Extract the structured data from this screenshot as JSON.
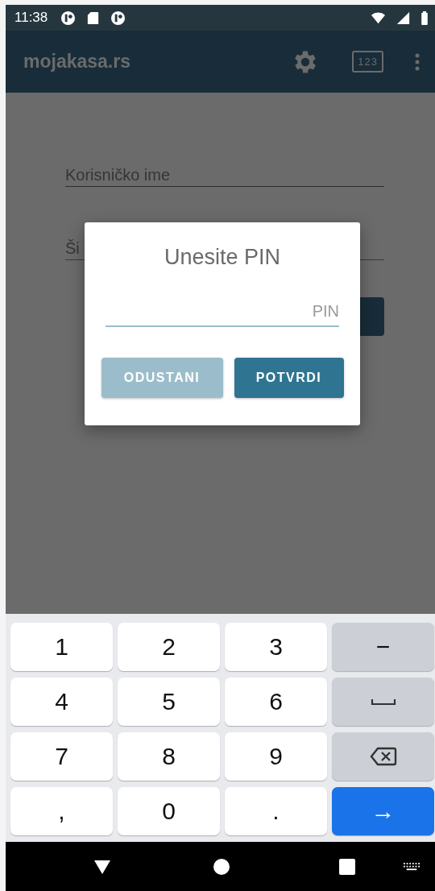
{
  "status_bar": {
    "time": "11:38"
  },
  "app_bar": {
    "title": "mojakasa.rs",
    "keypad_button": "123"
  },
  "login_form": {
    "username_placeholder": "Korisničko ime",
    "password_placeholder": "Ši"
  },
  "dialog": {
    "title": "Unesite PIN",
    "pin_placeholder": "PIN",
    "buttons": [
      {
        "label": "ODUSTANI",
        "kind": "cancel"
      },
      {
        "label": "POTVRDI",
        "kind": "confirm"
      }
    ]
  },
  "keyboard": {
    "keys": [
      {
        "kind": "char",
        "label": "1"
      },
      {
        "kind": "char",
        "label": "2"
      },
      {
        "kind": "char",
        "label": "3"
      },
      {
        "kind": "func",
        "label": "−"
      },
      {
        "kind": "char",
        "label": "4"
      },
      {
        "kind": "char",
        "label": "5"
      },
      {
        "kind": "char",
        "label": "6"
      },
      {
        "kind": "space"
      },
      {
        "kind": "char",
        "label": "7"
      },
      {
        "kind": "char",
        "label": "8"
      },
      {
        "kind": "char",
        "label": "9"
      },
      {
        "kind": "backspace"
      },
      {
        "kind": "char",
        "label": ","
      },
      {
        "kind": "char",
        "label": "0"
      },
      {
        "kind": "char",
        "label": "."
      },
      {
        "kind": "enter",
        "label": "→"
      }
    ]
  }
}
